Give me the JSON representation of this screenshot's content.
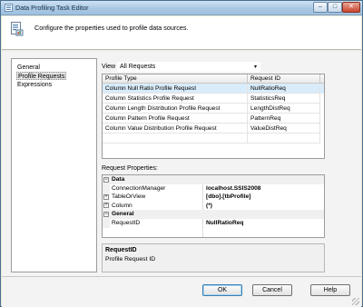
{
  "window": {
    "title": "Data Profiling Task Editor"
  },
  "header": {
    "text": "Configure the properties used to profile data sources.",
    "icon": "profiler-icon"
  },
  "nav": {
    "items": [
      {
        "label": "General"
      },
      {
        "label": "Profile Requests",
        "selected": true
      },
      {
        "label": "Expressions"
      }
    ]
  },
  "view": {
    "label": "View",
    "value": "All Requests"
  },
  "requests_grid": {
    "columns": [
      "Profile Type",
      "Request ID"
    ],
    "rows": [
      {
        "type": "Column Null Ratio Profile Request",
        "id": "NullRatioReq",
        "selected": true
      },
      {
        "type": "Column Statistics Profile Request",
        "id": "StatisticsReq"
      },
      {
        "type": "Column Length Distribution Profile Request",
        "id": "LengthDistReq"
      },
      {
        "type": "Column Pattern Profile Request",
        "id": "PatternReq"
      },
      {
        "type": "Column Value Distribution Profile Request",
        "id": "ValueDistReq"
      }
    ]
  },
  "properties": {
    "caption": "Request Properties:",
    "rows": [
      {
        "kind": "category",
        "expander": "⊟",
        "name": "Data"
      },
      {
        "kind": "prop",
        "name": "ConnectionManager",
        "value": "localhost.SSIS2008"
      },
      {
        "kind": "prop",
        "expander": "⊞",
        "name": "TableOrView",
        "value": "[dbo].[tbProfile]"
      },
      {
        "kind": "prop",
        "expander": "⊞",
        "name": "Column",
        "value": "(*)"
      },
      {
        "kind": "category",
        "expander": "⊟",
        "name": "General"
      },
      {
        "kind": "prop",
        "name": "RequestID",
        "value": "NullRatioReq"
      }
    ]
  },
  "description": {
    "title": "RequestID",
    "text": "Profile Request ID"
  },
  "buttons": {
    "ok": "OK",
    "cancel": "Cancel",
    "help": "Help"
  },
  "titlebar_buttons": {
    "minimize": "–",
    "maximize": "□",
    "close": "✕"
  }
}
